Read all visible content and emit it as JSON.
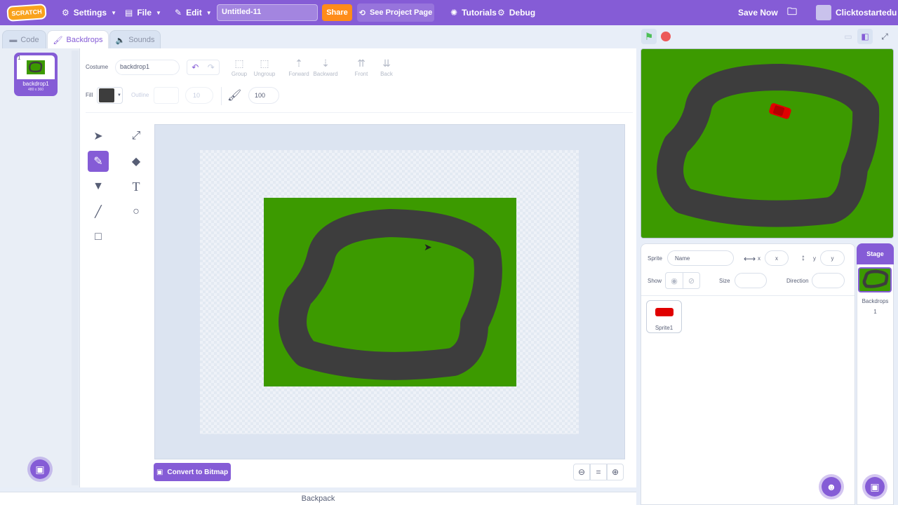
{
  "menu": {
    "logo": "SCRATCH",
    "settings": "Settings",
    "file": "File",
    "edit": "Edit",
    "project_title": "Untitled-11",
    "share": "Share",
    "see_project": "See Project Page",
    "tutorials": "Tutorials",
    "debug": "Debug",
    "save_now": "Save Now",
    "username": "Clicktostartedu"
  },
  "tabs": {
    "code": "Code",
    "backdrops": "Backdrops",
    "sounds": "Sounds"
  },
  "costume_list": {
    "items": [
      {
        "index": "1",
        "name": "backdrop1",
        "size": "480 x 360"
      }
    ]
  },
  "paint": {
    "costume_label": "Costume",
    "costume_name": "backdrop1",
    "group": "Group",
    "ungroup": "Ungroup",
    "forward": "Forward",
    "backward": "Backward",
    "front": "Front",
    "back": "Back",
    "fill_label": "Fill",
    "fill_color": "#3d3d3d",
    "outline_label": "Outline",
    "outline_width": "10",
    "brush_size": "100",
    "convert": "Convert to Bitmap",
    "active_tool": "brush"
  },
  "backpack": "Backpack",
  "sprite_info": {
    "sprite_label": "Sprite",
    "name_placeholder": "Name",
    "x_label": "x",
    "x_value": "x",
    "y_label": "y",
    "y_value": "y",
    "show_label": "Show",
    "size_label": "Size",
    "direction_label": "Direction"
  },
  "sprites": [
    {
      "name": "Sprite1"
    }
  ],
  "stage_pane": {
    "title": "Stage",
    "backdrops_label": "Backdrops",
    "backdrops_count": "1"
  },
  "colors": {
    "accent": "#855cd6",
    "share": "#ff8c1a",
    "grass": "#3c9a00",
    "track": "#3d3d3d",
    "car": "#e00000"
  }
}
